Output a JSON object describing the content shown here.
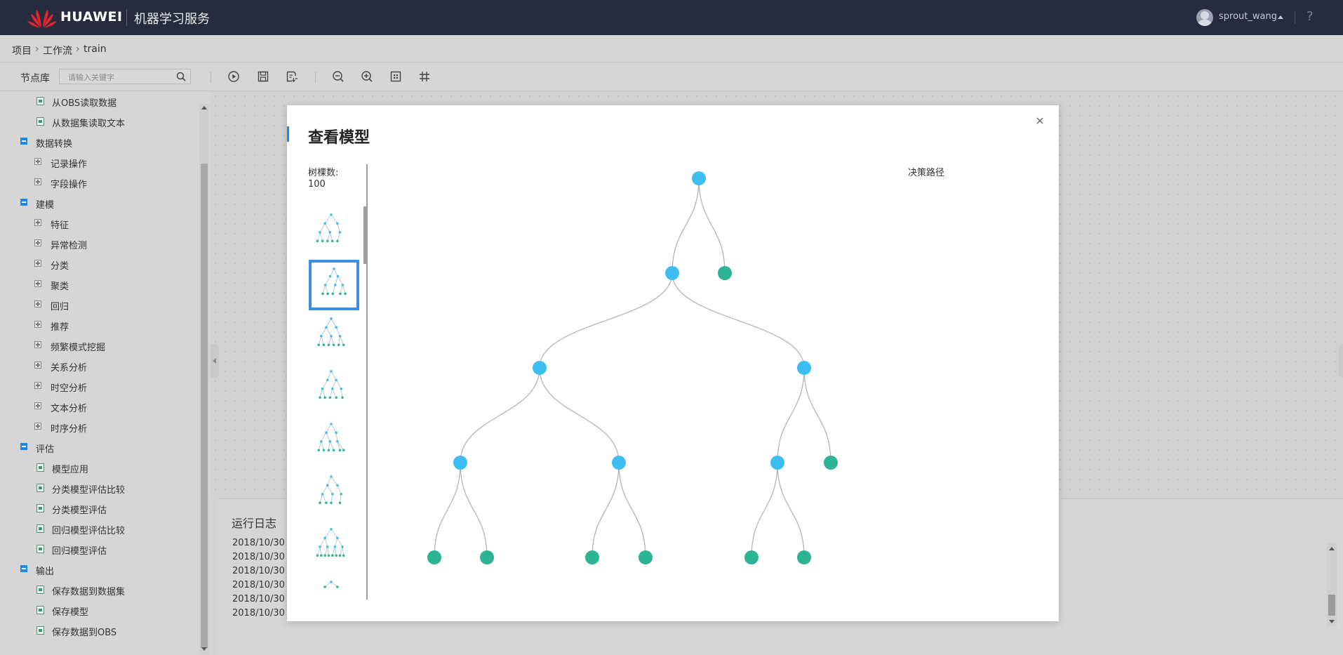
{
  "header": {
    "brand": "HUAWEI",
    "service": "机器学习服务",
    "username": "sprout_wang",
    "help": "?"
  },
  "breadcrumb": {
    "items": [
      "项目",
      "工作流",
      "train"
    ],
    "separator": "›"
  },
  "toolbar": {
    "node_library_label": "节点库",
    "search_placeholder": "请输入关键字",
    "icons": [
      "run-icon",
      "save-icon",
      "save-as-icon",
      "zoom-out-icon",
      "zoom-in-icon",
      "fit-view-icon",
      "grid-icon"
    ]
  },
  "sidebar": {
    "items": [
      {
        "label": "从OBS读取数据",
        "kind": "node"
      },
      {
        "label": "从数据集读取文本",
        "kind": "node"
      },
      {
        "label": "数据转换",
        "kind": "group"
      },
      {
        "label": "记录操作",
        "kind": "subgroup"
      },
      {
        "label": "字段操作",
        "kind": "subgroup"
      },
      {
        "label": "建模",
        "kind": "group"
      },
      {
        "label": "特征",
        "kind": "subgroup"
      },
      {
        "label": "异常检测",
        "kind": "subgroup"
      },
      {
        "label": "分类",
        "kind": "subgroup"
      },
      {
        "label": "聚类",
        "kind": "subgroup"
      },
      {
        "label": "回归",
        "kind": "subgroup"
      },
      {
        "label": "推荐",
        "kind": "subgroup"
      },
      {
        "label": "频繁模式挖掘",
        "kind": "subgroup"
      },
      {
        "label": "关系分析",
        "kind": "subgroup"
      },
      {
        "label": "时空分析",
        "kind": "subgroup"
      },
      {
        "label": "文本分析",
        "kind": "subgroup"
      },
      {
        "label": "时序分析",
        "kind": "subgroup"
      },
      {
        "label": "评估",
        "kind": "group"
      },
      {
        "label": "模型应用",
        "kind": "node"
      },
      {
        "label": "分类模型评估比较",
        "kind": "node"
      },
      {
        "label": "分类模型评估",
        "kind": "node"
      },
      {
        "label": "回归模型评估比较",
        "kind": "node"
      },
      {
        "label": "回归模型评估",
        "kind": "node"
      },
      {
        "label": "输出",
        "kind": "group"
      },
      {
        "label": "保存数据到数据集",
        "kind": "node"
      },
      {
        "label": "保存模型",
        "kind": "node"
      },
      {
        "label": "保存数据到OBS",
        "kind": "node"
      }
    ]
  },
  "log": {
    "title": "运行日志",
    "lines": [
      "2018/10/30",
      "2018/10/30",
      "2018/10/30",
      "2018/10/30",
      "2018/10/30",
      "2018/10/30"
    ]
  },
  "modal": {
    "title": "查看模型",
    "tree_count_label": "树棵数:",
    "tree_count": "100",
    "decision_path_label": "决策路径",
    "selected_thumbnail": 2,
    "colors": {
      "internal_node": "#3ebef0",
      "leaf_node": "#2db495",
      "edge": "#b5b5b5",
      "selection": "#3a8ee6"
    }
  }
}
